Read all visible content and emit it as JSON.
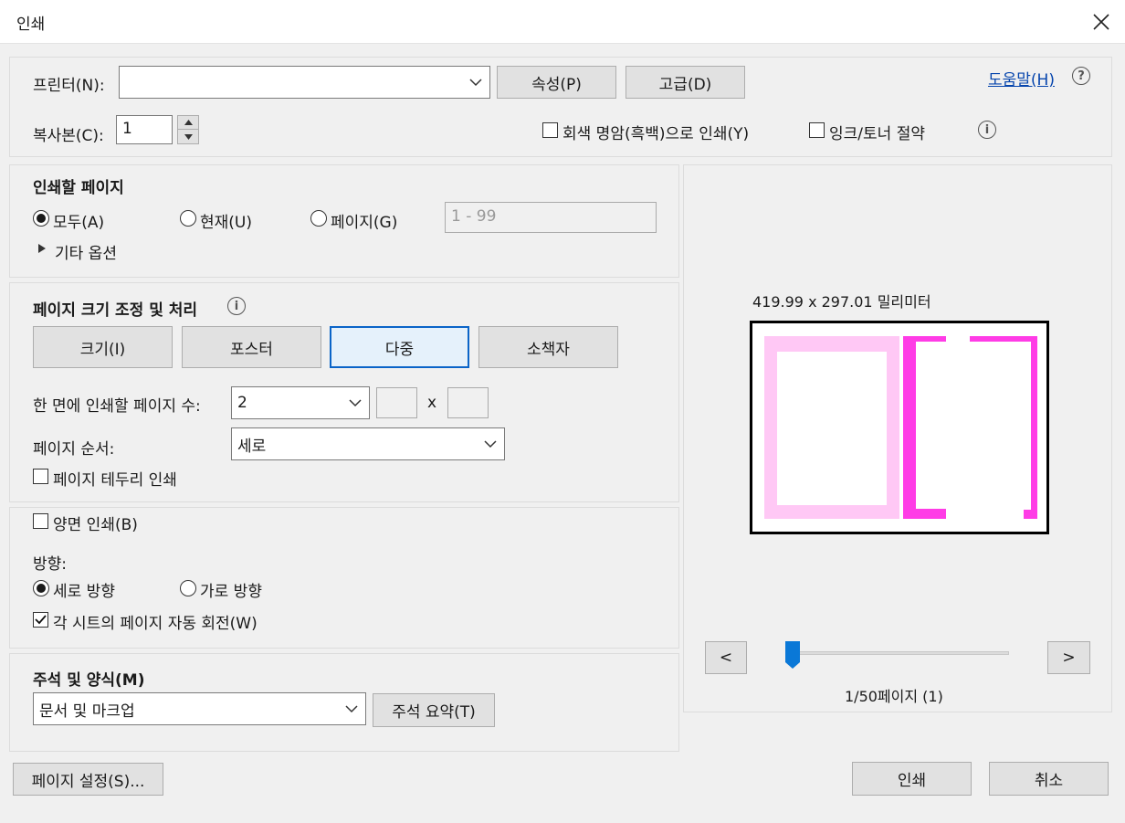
{
  "window": {
    "title": "인쇄"
  },
  "printer": {
    "label": "프린터(N):",
    "value": "",
    "properties_button": "속성(P)",
    "advanced_button": "고급(D)",
    "help_link": "도움말(H)"
  },
  "copies": {
    "label": "복사본(C):",
    "value": "1",
    "grayscale_label": "회색 명암(흑백)으로 인쇄(Y)",
    "grayscale_checked": false,
    "ink_saver_label": "잉크/토너 절약",
    "ink_saver_checked": false
  },
  "pages_to_print": {
    "heading": "인쇄할 페이지",
    "options": [
      {
        "label": "모두(A)",
        "checked": true
      },
      {
        "label": "현재(U)",
        "checked": false
      },
      {
        "label": "페이지(G)",
        "checked": false
      }
    ],
    "range_placeholder": "1 - 99",
    "more_options": "기타 옵션"
  },
  "sizing": {
    "heading": "페이지 크기 조정 및 처리",
    "tabs": [
      "크기(I)",
      "포스터",
      "다중",
      "소책자"
    ],
    "active_tab": "다중",
    "pages_per_sheet_label": "한 면에 인쇄할 페이지 수:",
    "pages_per_sheet_value": "2",
    "x_label": "x",
    "page_order_label": "페이지 순서:",
    "page_order_value": "세로",
    "print_border_label": "페이지 테두리 인쇄",
    "print_border_checked": false
  },
  "duplex": {
    "label": "양면 인쇄(B)",
    "checked": false
  },
  "orientation": {
    "heading": "방향:",
    "options": [
      {
        "label": "세로 방향",
        "checked": true
      },
      {
        "label": "가로 방향",
        "checked": false
      }
    ],
    "auto_rotate_label": "각 시트의 페이지 자동 회전(W)",
    "auto_rotate_checked": true
  },
  "comments": {
    "heading": "주석 및 양식(M)",
    "value": "문서 및 마크업",
    "summary_button": "주석 요약(T)"
  },
  "preview": {
    "dimensions": "419.99 x 297.01 밀리미터",
    "prev_button": "<",
    "next_button": ">",
    "page_indicator": "1/50페이지 (1)",
    "slider_fraction": 0.0
  },
  "footer": {
    "page_setup_button": "페이지 설정(S)...",
    "print_button": "인쇄",
    "cancel_button": "취소"
  },
  "colors": {
    "accent": "#0a64c8",
    "preview_light_pink": "#ffc8f5",
    "preview_magenta": "#ff3ce6"
  }
}
